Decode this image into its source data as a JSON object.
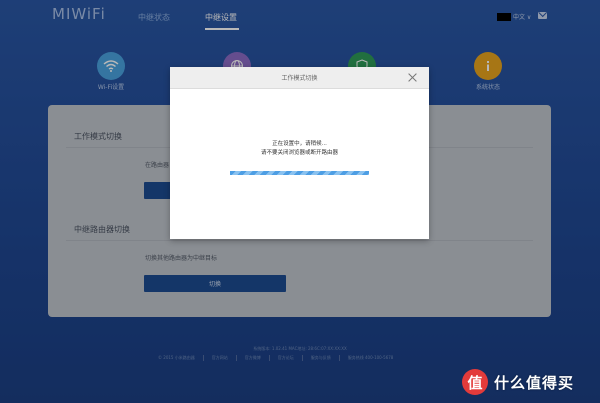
{
  "header": {
    "logo": "MIWiFi",
    "nav": [
      {
        "label": "中继状态",
        "active": false
      },
      {
        "label": "中继设置",
        "active": true
      }
    ],
    "lang": "中文 ∨"
  },
  "circles": [
    {
      "label": "Wi-Fi设置",
      "icon": "wifi-icon",
      "color": "#4aa3df"
    },
    {
      "label": "",
      "icon": "globe-icon",
      "color": "#8c6bc5"
    },
    {
      "label": "",
      "icon": "shield-icon",
      "color": "#2f9a58"
    },
    {
      "label": "系统状态",
      "icon": "info-icon",
      "color": "#e8a41e"
    }
  ],
  "panel": {
    "section1_title": "工作模式切换",
    "section1_text": "在路由器",
    "section2_title": "中继路由器切换",
    "section2_text": "切换其他路由器为中继目标",
    "switch_button": "切换"
  },
  "footer": {
    "line1": "系统版本: 1.02.41 MAC地址: 28:6C:07:XX:XX:XX",
    "links": [
      "© 2015 小米路由器",
      "官方网站",
      "官方微博",
      "官方论坛",
      "服务与反馈",
      "服务热线 400-100-5678"
    ]
  },
  "modal": {
    "title": "工作模式切换",
    "line1": "正在设置中，请稍候...",
    "line2": "请不要关闭浏览器或断开路由器",
    "progress": 1.0
  },
  "watermark": {
    "logo": "值",
    "text": "什么值得买"
  }
}
